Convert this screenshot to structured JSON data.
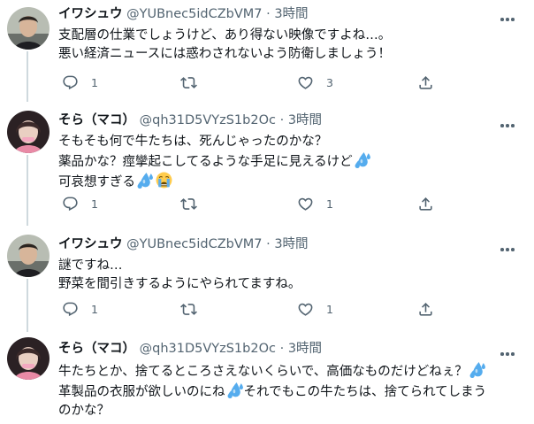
{
  "tweets": [
    {
      "name": "イワシュウ",
      "handle": "@YUBnec5idCZbVM7",
      "dot": "·",
      "time": "3時間",
      "lines": [
        "支配層の仕業でしょうけど、あり得ない映像ですよね…。",
        "悪い経済ニュースには惑わされないよう防衛しましょう！"
      ],
      "reply_count": "1",
      "retweet_count": "",
      "like_count": "3"
    },
    {
      "name": "そら（マコ）",
      "handle": "@qh31D5VYzS1b2Oc",
      "dot": "·",
      "time": "3時間",
      "lines": [
        "そもそも何で牛たちは、死んじゃったのかな？",
        "薬品かな？痙攣起こしてるような手足に見えるけど",
        "可哀想すぎる"
      ],
      "reply_count": "1",
      "retweet_count": "",
      "like_count": "1"
    },
    {
      "name": "イワシュウ",
      "handle": "@YUBnec5idCZbVM7",
      "dot": "·",
      "time": "3時間",
      "lines": [
        "謎ですね…",
        "野菜を間引きするようにやられてますね。"
      ],
      "reply_count": "1",
      "retweet_count": "",
      "like_count": "1"
    },
    {
      "name": "そら（マコ）",
      "handle": "@qh31D5VYzS1b2Oc",
      "dot": "·",
      "time": "3時間",
      "lines": [
        "牛たちとか、捨てるところさえないくらいで、高価なものだけどねぇ？",
        "革製品の衣服が欲しいのにね",
        "それでもこの牛たちは、捨てられてしまう",
        "のかな？"
      ]
    }
  ],
  "icons": {
    "reply": "reply-icon",
    "retweet": "retweet-icon",
    "like": "heart-icon",
    "share": "share-icon",
    "more": "more-icon",
    "sweat": "sweat-droplets-emoji",
    "cry": "crying-face-emoji"
  },
  "colors": {
    "text": "#0f1419",
    "secondary": "#536471",
    "thread_line": "#cfd9de",
    "emoji_blue": "#55acee",
    "emoji_yellow": "#ffcc4d"
  }
}
